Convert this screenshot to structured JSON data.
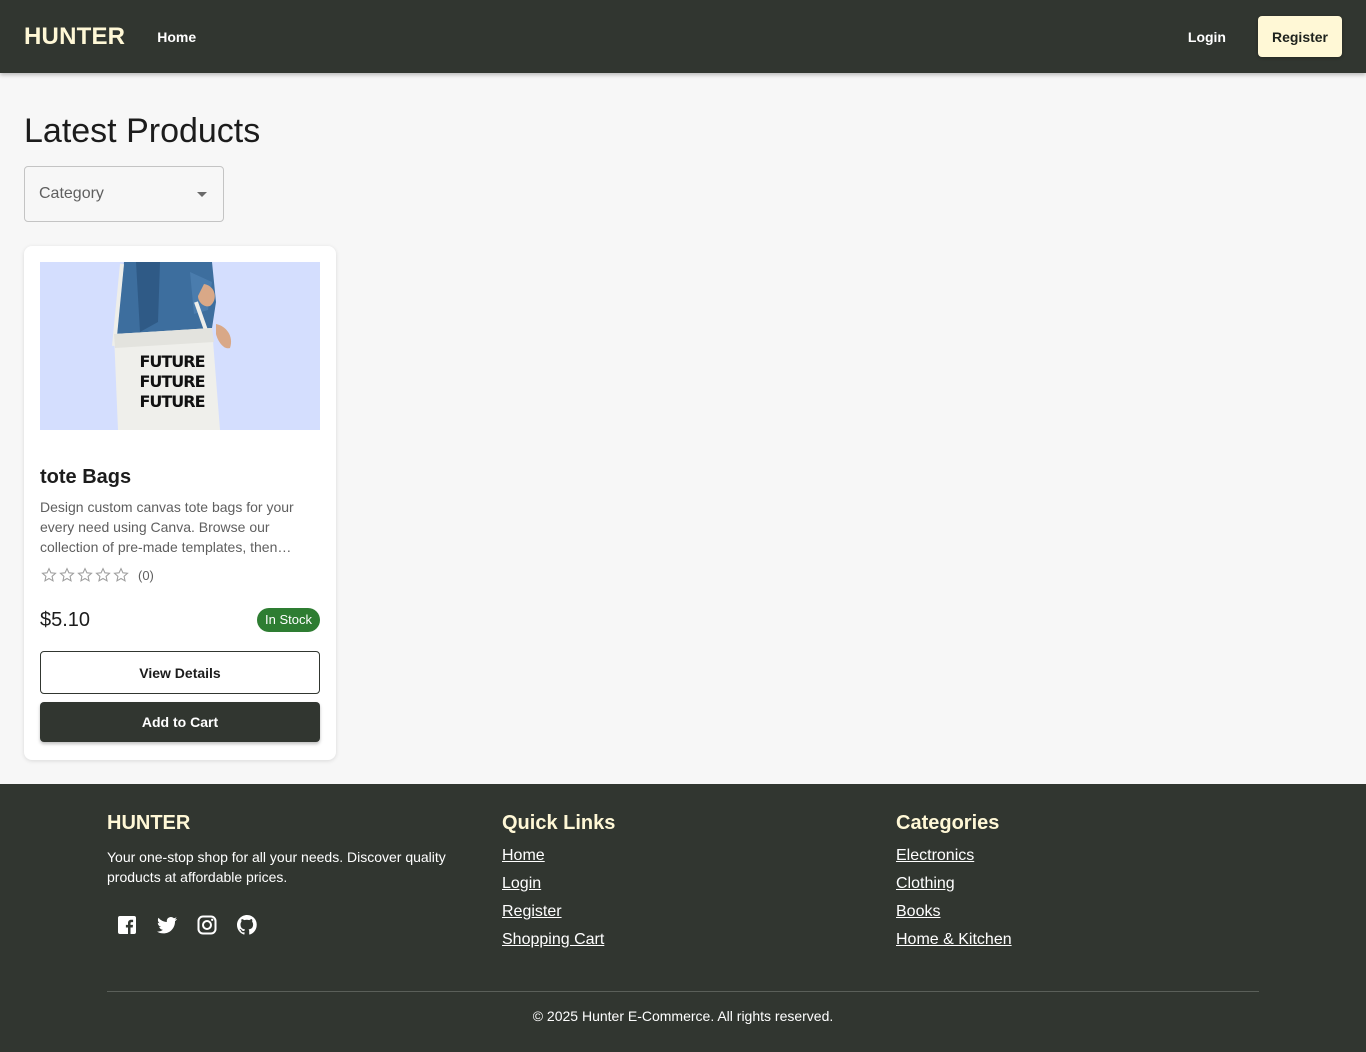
{
  "header": {
    "brand": "HUNTER",
    "nav_home": "Home",
    "login": "Login",
    "register": "Register"
  },
  "main": {
    "title": "Latest Products",
    "category_select": {
      "label": "Category"
    },
    "products": [
      {
        "name": "tote Bags",
        "image_text": "FUTURE FUTURE FUTURE",
        "description": "Design custom canvas tote bags for your every need using Canva. Browse our collection of pre-made templates, then…",
        "rating": 0,
        "rating_max": 5,
        "rating_count": "(0)",
        "price": "$5.10",
        "stock": "In Stock",
        "view_details": "View Details",
        "add_to_cart": "Add to Cart"
      }
    ]
  },
  "footer": {
    "brand": "HUNTER",
    "tagline": "Your one-stop shop for all your needs. Discover quality products at affordable prices.",
    "socials": [
      "facebook-icon",
      "twitter-icon",
      "instagram-icon",
      "github-icon"
    ],
    "quick_links": {
      "title": "Quick Links",
      "items": [
        "Home",
        "Login",
        "Register",
        "Shopping Cart"
      ]
    },
    "categories": {
      "title": "Categories",
      "items": [
        "Electronics",
        "Clothing",
        "Books",
        "Home & Kitchen"
      ]
    },
    "copyright": "© 2025 Hunter E-Commerce. All rights reserved."
  },
  "colors": {
    "primary_dark": "#313630",
    "accent_cream": "#fff8d6",
    "success": "#2e7d32",
    "product_bg": "#d4defe"
  }
}
